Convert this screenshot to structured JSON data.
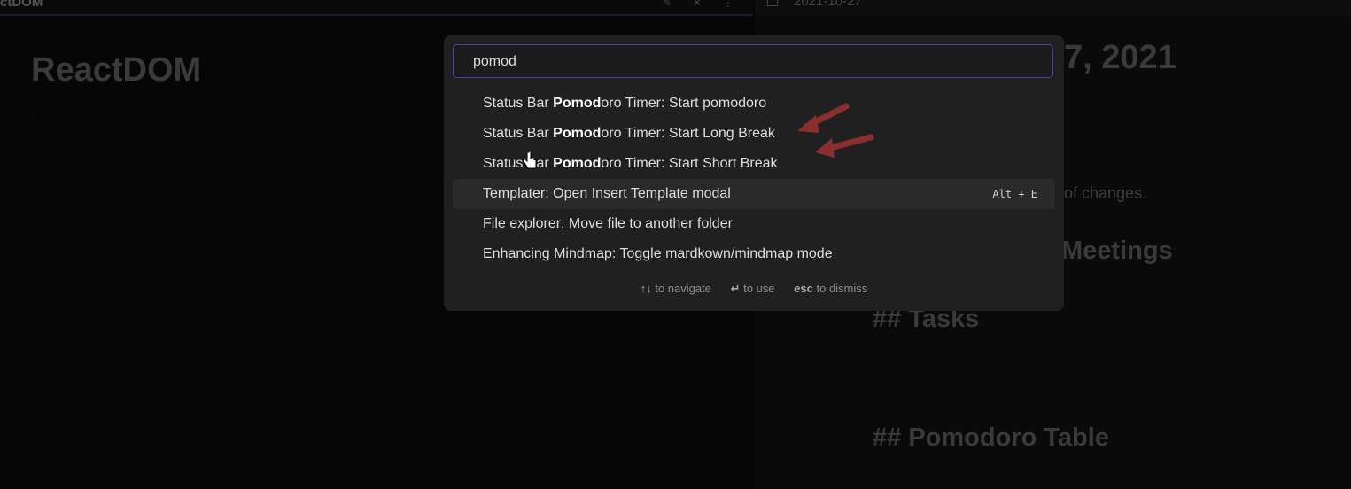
{
  "left": {
    "tab_title": "ctDOM",
    "title": "ReactDOM"
  },
  "right": {
    "date_tab": "2021-10-27",
    "heading_date": "7, 2021",
    "changes_text": "of changes.",
    "meetings_heading": "Meetings",
    "tasks_heading": "## Tasks",
    "pomodoro_heading": "## Pomodoro Table"
  },
  "palette": {
    "query": "pomod",
    "suggestions": [
      {
        "pre": "Status Bar ",
        "bold": "Pomod",
        "post": "oro Timer: Start pomodoro",
        "hotkey": ""
      },
      {
        "pre": "Status Bar ",
        "bold": "Pomod",
        "post": "oro Timer: Start Long Break",
        "hotkey": ""
      },
      {
        "pre": "Status Bar ",
        "bold": "Pomod",
        "post": "oro Timer: Start Short Break",
        "hotkey": ""
      },
      {
        "pre": "Templater: Open Insert Template modal",
        "bold": "",
        "post": "",
        "hotkey": "Alt + E"
      },
      {
        "pre": "File explorer: Move file to another folder",
        "bold": "",
        "post": "",
        "hotkey": ""
      },
      {
        "pre": "Enhancing Mindmap: Toggle mardkown/mindmap mode",
        "bold": "",
        "post": "",
        "hotkey": ""
      }
    ],
    "footer": {
      "navigate_key": "↑↓",
      "navigate_label": "to navigate",
      "use_key": "↵",
      "use_label": "to use",
      "dismiss_key": "esc",
      "dismiss_label": "to dismiss"
    }
  },
  "colors": {
    "accent": "#4d3fb0",
    "annotation_arrow": "#8b2e2e"
  }
}
